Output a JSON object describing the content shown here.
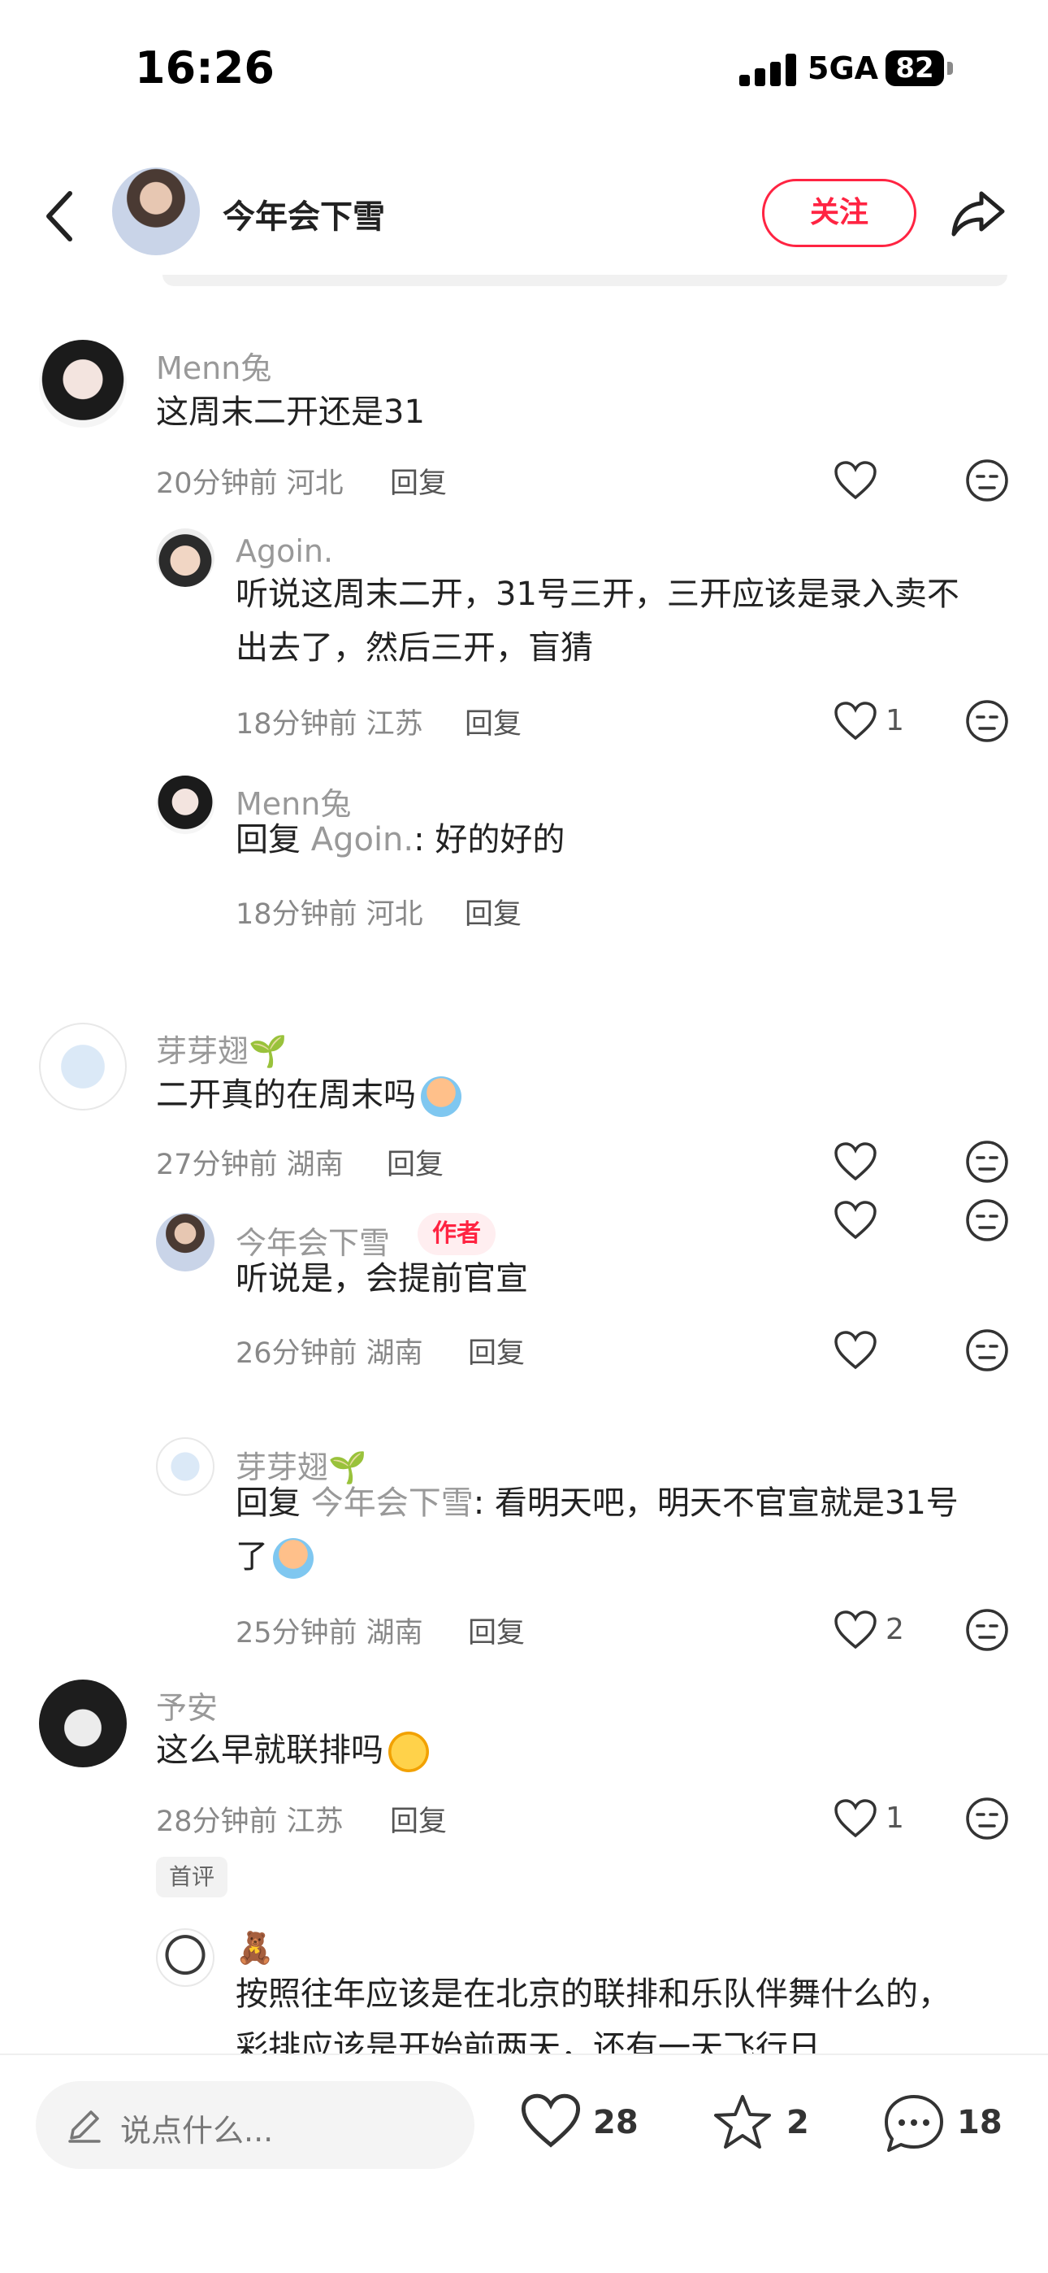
{
  "status_bar": {
    "time": "16:26",
    "network": "5GA",
    "battery": "82"
  },
  "header": {
    "title": "今年会下雪",
    "follow_label": "关注"
  },
  "comments": [
    {
      "user": "Menn兔",
      "text": "这周末二开还是31",
      "time_location": "20分钟前 河北",
      "reply_label": "回复",
      "likes": "",
      "replies": [
        {
          "user": "Agoin.",
          "text_line1": "听说这周末二开，31号三开，三开应该是录入卖不",
          "text_line2": "出去了，然后三开，盲猜",
          "time_location": "18分钟前 江苏",
          "reply_label": "回复",
          "likes": "1"
        },
        {
          "user": "Menn兔",
          "reply_prefix": "回复",
          "reply_to": "Agoin.",
          "text": ": 好的好的",
          "time_location": "18分钟前 河北",
          "reply_label": "回复",
          "likes": ""
        }
      ]
    },
    {
      "user": "芽芽翅🌱",
      "text": "二开真的在周末吗",
      "time_location": "27分钟前 湖南",
      "reply_label": "回复",
      "likes": "",
      "replies": [
        {
          "user": "今年会下雪",
          "badge": "作者",
          "text": "听说是，会提前官宣",
          "time_location": "26分钟前 湖南",
          "reply_label": "回复",
          "likes": ""
        },
        {
          "user": "芽芽翅🌱",
          "reply_prefix": "回复",
          "reply_to": "今年会下雪",
          "text_line1": ": 看明天吧，明天不官宣就是31号",
          "text_line2": "了",
          "time_location": "25分钟前 湖南",
          "reply_label": "回复",
          "likes": "2"
        }
      ]
    },
    {
      "user": "予安",
      "text": "这么早就联排吗",
      "time_location": "28分钟前 江苏",
      "reply_label": "回复",
      "likes": "1",
      "badge": "首评",
      "replies": [
        {
          "user": "🧸",
          "text_line1": "按照往年应该是在北京的联排和乐队伴舞什么的，",
          "text_line2": "彩排应该是开始前两天，还有一天飞行日"
        }
      ]
    }
  ],
  "bottom_bar": {
    "input_placeholder": "说点什么...",
    "likes": "28",
    "stars": "2",
    "comments": "18"
  },
  "colors": {
    "accent": "#ff2442",
    "muted_text": "#999999"
  }
}
